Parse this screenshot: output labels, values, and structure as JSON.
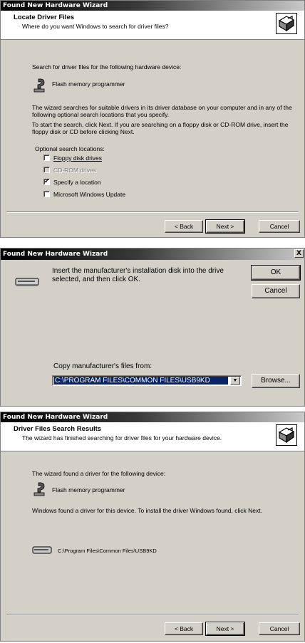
{
  "wizard1": {
    "title": "Found New Hardware Wizard",
    "header_title": "Locate Driver Files",
    "header_subtitle": "Where do you want Windows to search for driver files?",
    "search_for_text": "Search for driver files for the following hardware device:",
    "device_name": "Flash memory programmer",
    "para1": "The wizard searches for suitable drivers in its driver database on your computer and in any of the following optional search locations that you specify.",
    "para2": "To start the search, click Next. If you are searching on a floppy disk or CD-ROM drive, insert the floppy disk or CD before clicking Next.",
    "optional_label": "Optional search locations:",
    "options": [
      {
        "label": "Floppy disk drives",
        "checked": false,
        "enabled": true
      },
      {
        "label": "CD-ROM drives",
        "checked": false,
        "enabled": false
      },
      {
        "label": "Specify a location",
        "checked": true,
        "enabled": true
      },
      {
        "label": "Microsoft Windows Update",
        "checked": false,
        "enabled": true
      }
    ],
    "back_label": "< Back",
    "next_label": "Next >",
    "cancel_label": "Cancel"
  },
  "dialog": {
    "title": "Found New Hardware Wizard",
    "close_label": "X",
    "message": "Insert the manufacturer's installation disk into the drive selected, and then click OK.",
    "ok_label": "OK",
    "cancel_label": "Cancel",
    "copy_label": "Copy manufacturer's files from:",
    "path_value": "C:\\PROGRAM FILES\\COMMON FILES\\USB9KD",
    "browse_label": "Browse..."
  },
  "wizard2": {
    "title": "Found New Hardware Wizard",
    "header_title": "Driver Files Search Results",
    "header_subtitle": "The wizard has finished searching for driver files for your hardware device.",
    "found_text": "The wizard found a driver for the following device:",
    "device_name": "Flash memory programmer",
    "found_driver_text": "Windows found a driver for this device. To install the driver Windows found, click Next.",
    "driver_path": "C:\\Program Files\\Common Files\\USB9KD",
    "back_label": "< Back",
    "next_label": "Next >",
    "cancel_label": "Cancel"
  }
}
